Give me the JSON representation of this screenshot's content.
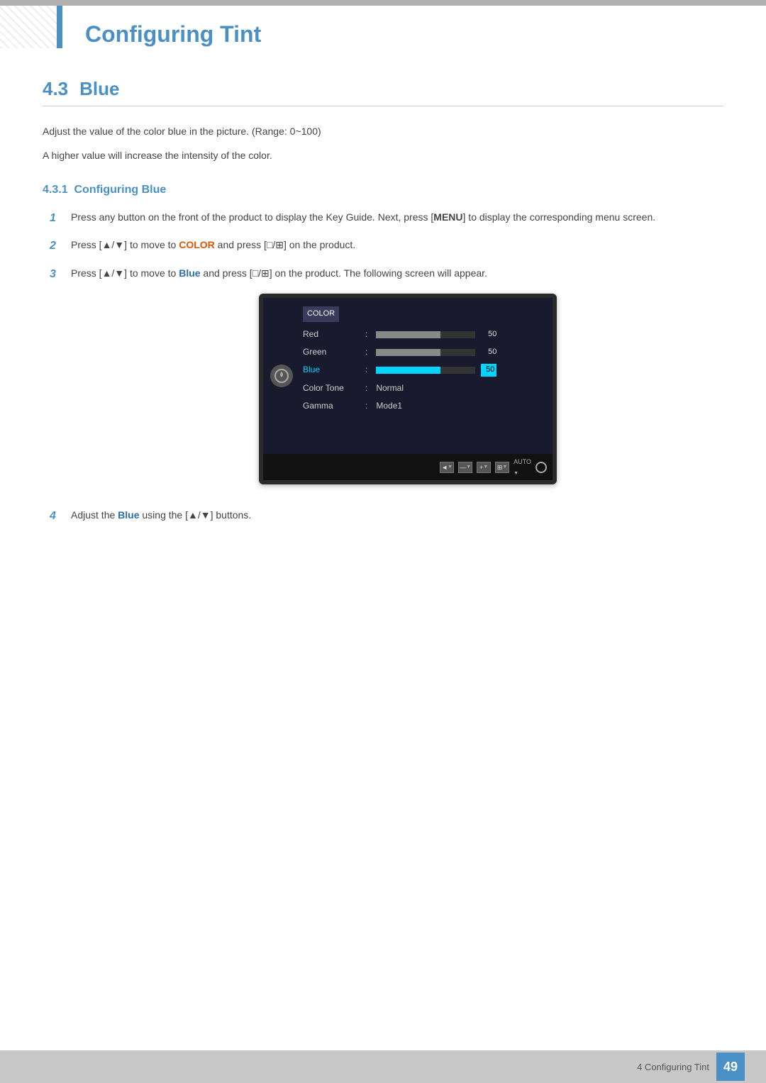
{
  "page": {
    "title": "Configuring Tint",
    "footer_text": "4 Configuring Tint",
    "page_number": "49"
  },
  "section": {
    "number": "4.3",
    "title": "Blue",
    "paragraph1": "Adjust the value of the color blue in the picture. (Range: 0~100)",
    "paragraph2": "A higher value will increase the intensity of the color.",
    "subsection_number": "4.3.1",
    "subsection_title": "Configuring Blue"
  },
  "steps": [
    {
      "number": "1",
      "text_parts": [
        {
          "text": "Press any button on the front of the product to display the Key Guide. Next, press [",
          "type": "normal"
        },
        {
          "text": "MENU",
          "type": "bold"
        },
        {
          "text": "] to display the corresponding menu screen.",
          "type": "normal"
        }
      ]
    },
    {
      "number": "2",
      "text_parts": [
        {
          "text": "Press [▲/▼] to move to ",
          "type": "normal"
        },
        {
          "text": "COLOR",
          "type": "highlight-color"
        },
        {
          "text": " and press [□/⊞] on the product.",
          "type": "normal"
        }
      ]
    },
    {
      "number": "3",
      "text_parts": [
        {
          "text": "Press [▲/▼] to move to ",
          "type": "normal"
        },
        {
          "text": "Blue",
          "type": "highlight-blue"
        },
        {
          "text": " and press [□/⊞] on the product. The following screen will appear.",
          "type": "normal"
        }
      ]
    },
    {
      "number": "4",
      "text_parts": [
        {
          "text": "Adjust the ",
          "type": "normal"
        },
        {
          "text": "Blue",
          "type": "highlight-blue"
        },
        {
          "text": " using the [▲/▼] buttons.",
          "type": "normal"
        }
      ]
    }
  ],
  "monitor": {
    "menu_title": "COLOR",
    "items": [
      {
        "label": "Red",
        "type": "bar",
        "value": 50,
        "fill_pct": 65,
        "active": false
      },
      {
        "label": "Green",
        "type": "bar",
        "value": 50,
        "fill_pct": 65,
        "active": false
      },
      {
        "label": "Blue",
        "type": "bar",
        "value": 50,
        "fill_pct": 65,
        "active": true
      },
      {
        "label": "Color Tone",
        "type": "text",
        "value": "Normal",
        "active": false
      },
      {
        "label": "Gamma",
        "type": "text",
        "value": "Mode1",
        "active": false
      }
    ],
    "toolbar_labels": [
      "◄",
      "—",
      "+",
      "⊞",
      "AUTO",
      "⏻"
    ]
  }
}
